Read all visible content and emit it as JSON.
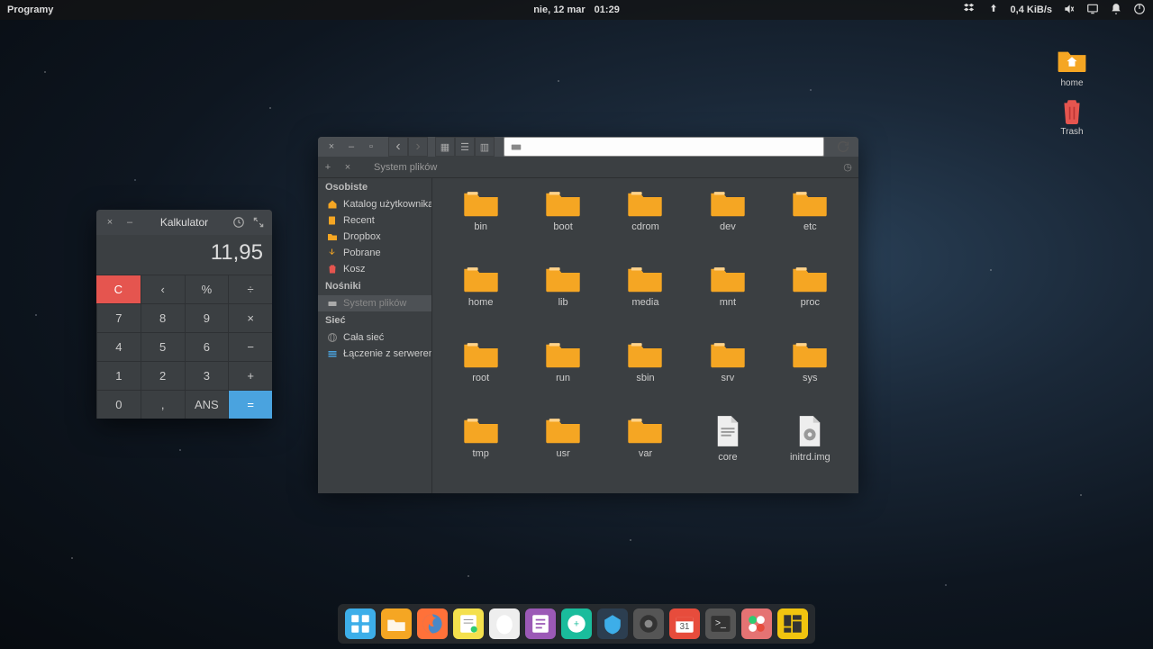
{
  "panel": {
    "menu": "Programy",
    "date": "nie, 12 mar",
    "time": "01:29",
    "net_speed": "0,4 KiB/s"
  },
  "desktop": {
    "home": "home",
    "trash": "Trash"
  },
  "calc": {
    "title": "Kalkulator",
    "display": "11,95",
    "keys": {
      "c": "C",
      "back": "‹",
      "pct": "%",
      "div": "÷",
      "7": "7",
      "8": "8",
      "9": "9",
      "mul": "×",
      "4": "4",
      "5": "5",
      "6": "6",
      "sub": "−",
      "1": "1",
      "2": "2",
      "3": "3",
      "add": "+",
      "0": "0",
      "dot": ",",
      "ans": "ANS",
      "eq": "="
    }
  },
  "fm": {
    "tab": "System plików",
    "sidebar": {
      "personal_h": "Osobiste",
      "personal": [
        "Katalog użytkownika",
        "Recent",
        "Dropbox",
        "Pobrane",
        "Kosz"
      ],
      "devices_h": "Nośniki",
      "devices": [
        "System plików"
      ],
      "network_h": "Sieć",
      "network": [
        "Cała sieć",
        "Łączenie z serwerem…"
      ]
    },
    "items": [
      {
        "n": "bin",
        "t": "d"
      },
      {
        "n": "boot",
        "t": "d"
      },
      {
        "n": "cdrom",
        "t": "d"
      },
      {
        "n": "dev",
        "t": "d"
      },
      {
        "n": "etc",
        "t": "d"
      },
      {
        "n": "home",
        "t": "d"
      },
      {
        "n": "lib",
        "t": "d"
      },
      {
        "n": "media",
        "t": "d"
      },
      {
        "n": "mnt",
        "t": "d"
      },
      {
        "n": "proc",
        "t": "d"
      },
      {
        "n": "root",
        "t": "d"
      },
      {
        "n": "run",
        "t": "d"
      },
      {
        "n": "sbin",
        "t": "d"
      },
      {
        "n": "srv",
        "t": "d"
      },
      {
        "n": "sys",
        "t": "d"
      },
      {
        "n": "tmp",
        "t": "d"
      },
      {
        "n": "usr",
        "t": "d"
      },
      {
        "n": "var",
        "t": "d"
      },
      {
        "n": "core",
        "t": "f"
      },
      {
        "n": "initrd.img",
        "t": "i"
      }
    ]
  },
  "dock": {
    "apps": [
      "multitask",
      "files",
      "firefox",
      "notes",
      "egg",
      "editor",
      "updater",
      "veracrypt",
      "obs",
      "calendar",
      "terminal",
      "settings",
      "tiler"
    ]
  }
}
